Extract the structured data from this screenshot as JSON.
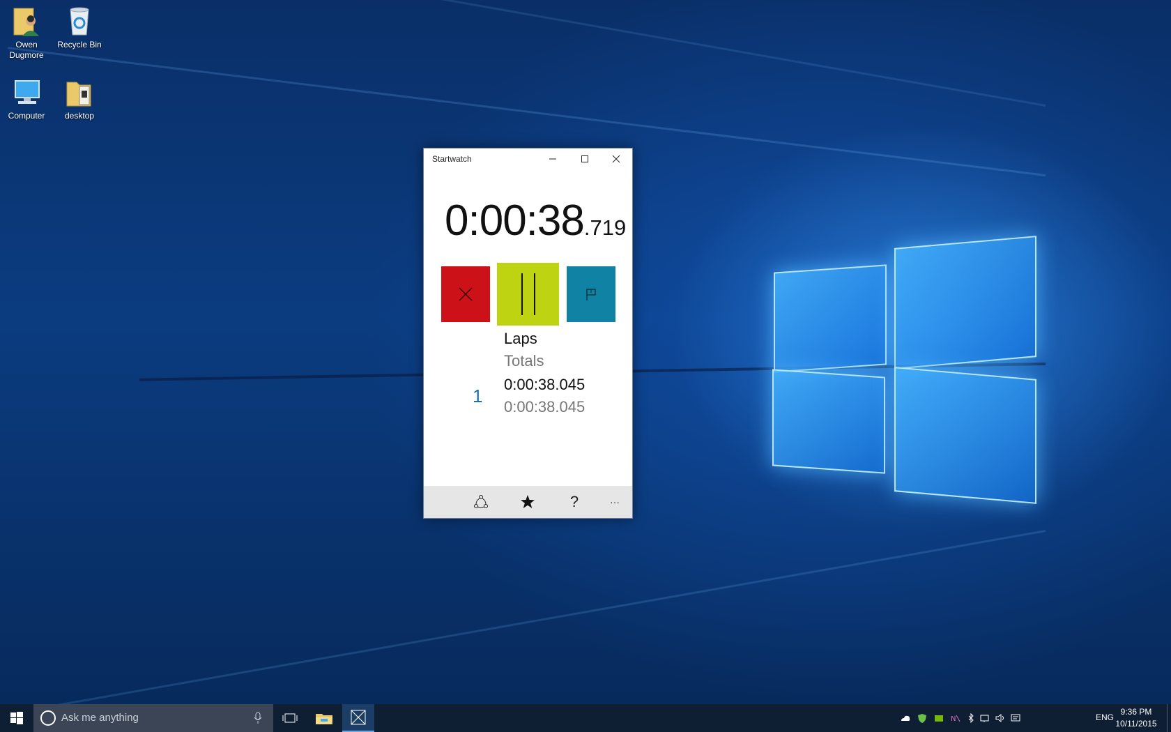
{
  "desktop": {
    "icons": [
      {
        "label": "Owen Dugmore"
      },
      {
        "label": "Recycle Bin"
      },
      {
        "label": "Computer"
      },
      {
        "label": "desktop"
      }
    ]
  },
  "app": {
    "title": "Startwatch",
    "time_main": "0:00:38",
    "time_ms": ".719",
    "buttons": {
      "reset_color": "#cc1118",
      "pause_color": "#bed311",
      "lap_color": "#1083a4"
    },
    "laps_header": "Laps",
    "totals_header": "Totals",
    "laps": [
      {
        "number": "1",
        "lap_time": "0:00:38.045",
        "total_time": "0:00:38.045"
      }
    ],
    "appbar": {
      "share_icon": "share-icon",
      "favorite_icon": "star-icon",
      "help_label": "?",
      "more_label": "···"
    }
  },
  "taskbar": {
    "search_placeholder": "Ask me anything",
    "language": "ENG",
    "time": "9:36 PM",
    "date": "10/11/2015"
  }
}
